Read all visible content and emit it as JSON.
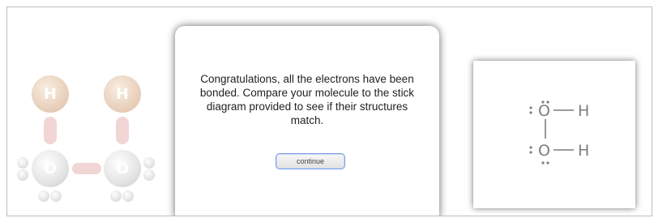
{
  "molecule": {
    "hydrogen_symbol": "H",
    "oxygen_symbol": "O"
  },
  "stick_diagram": {
    "top_row": {
      "left_atom": "O",
      "right_atom": "H"
    },
    "bottom_row": {
      "left_atom": "O",
      "right_atom": "H"
    }
  },
  "dialog": {
    "message": "Congratulations, all the electrons have been bonded. Compare your molecule to the stick diagram provided to see if their structures match.",
    "continue_label": "continue"
  },
  "colors": {
    "hydrogen": "#cf9a6c",
    "oxygen": "#c9c9c9",
    "bond": "#e3a3a3",
    "button_border": "#7a9ee3"
  }
}
